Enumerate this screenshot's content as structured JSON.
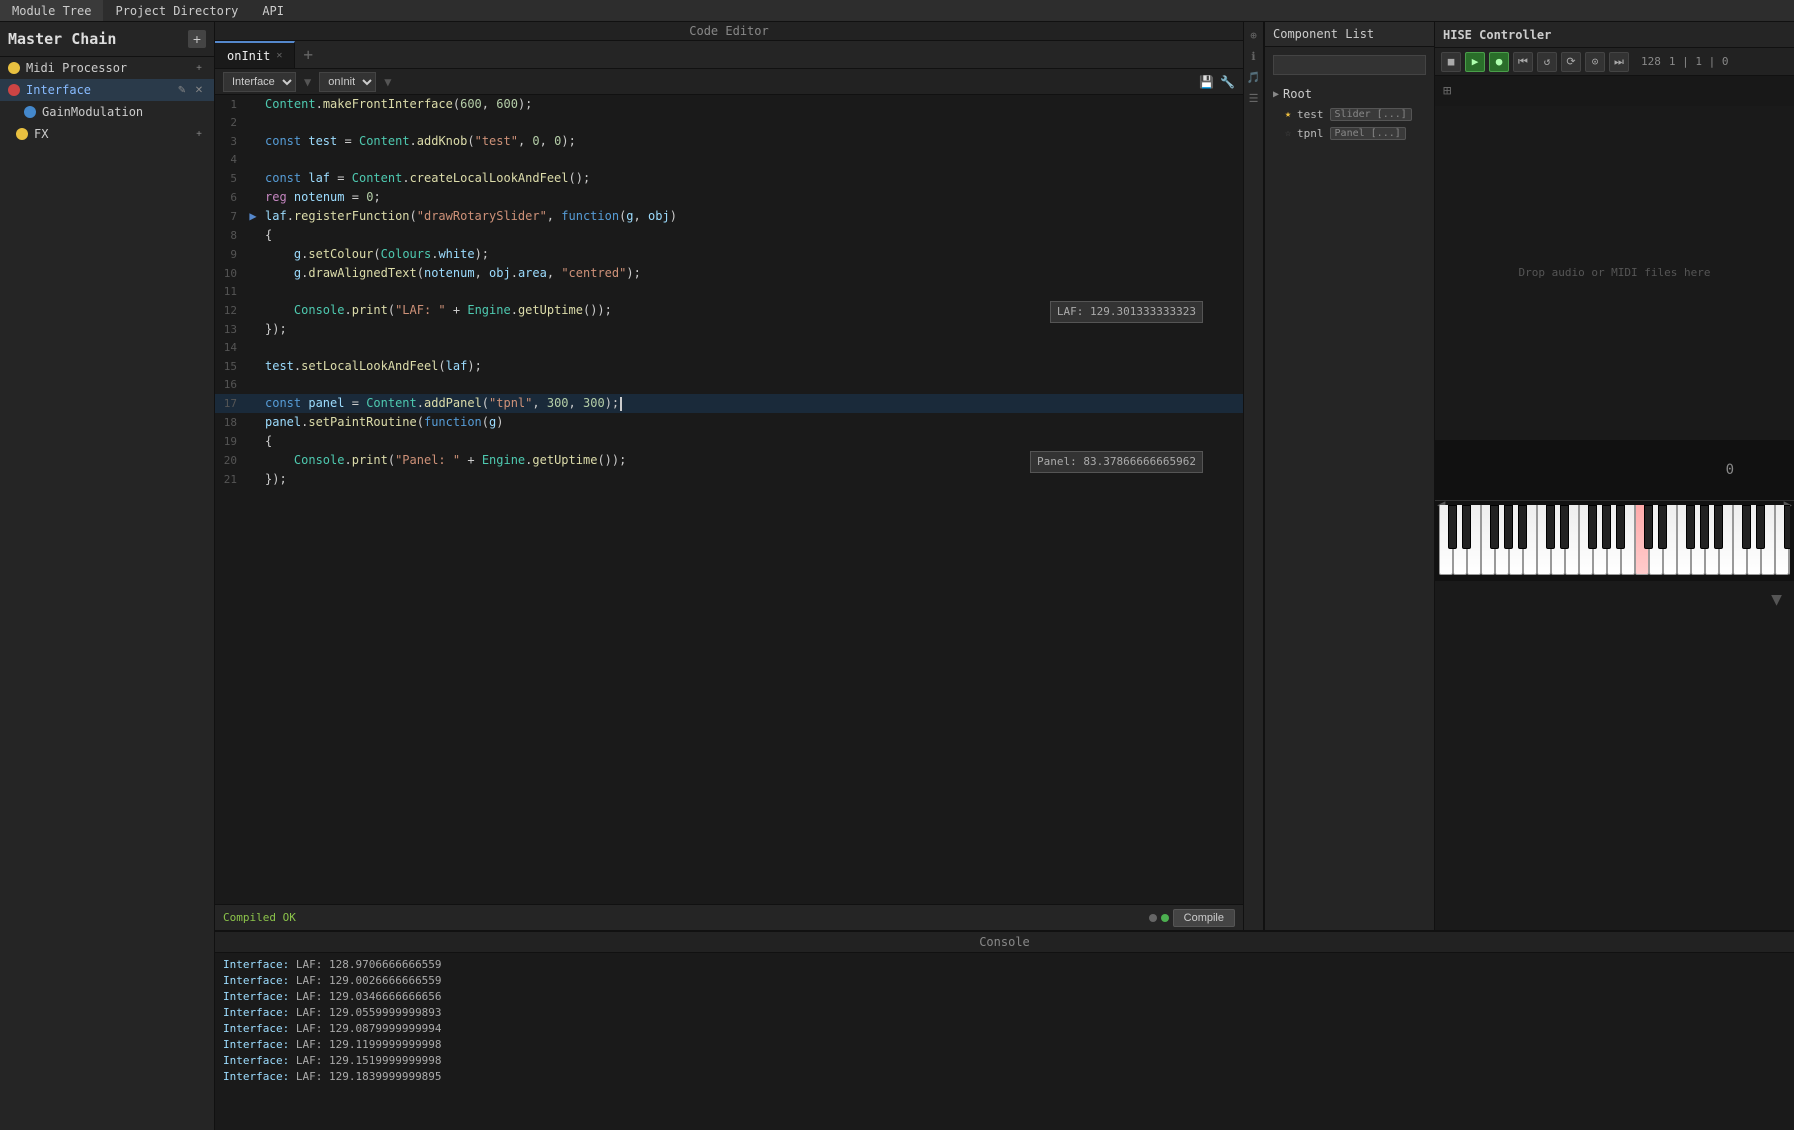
{
  "topMenu": {
    "items": [
      "Module Tree",
      "Project Directory",
      "API"
    ]
  },
  "leftPanel": {
    "masterChain": {
      "title": "Master Chain"
    },
    "modules": [
      {
        "id": "midi-processor",
        "name": "Midi Processor",
        "dotClass": "dot-yellow",
        "indent": 0
      },
      {
        "id": "interface",
        "name": "Interface",
        "dotClass": "dot-red",
        "indent": 0,
        "active": true
      },
      {
        "id": "gain-modulation",
        "name": "GainModulation",
        "dotClass": "dot-blue",
        "indent": 0
      },
      {
        "id": "fx",
        "name": "FX",
        "dotClass": "dot-yellow",
        "indent": 0
      }
    ]
  },
  "editorTabs": {
    "title": "Code Editor",
    "tabs": [
      {
        "label": "onInit",
        "active": true,
        "closeable": true
      }
    ],
    "addLabel": "+",
    "toolbar": {
      "fileSelect": "Interface",
      "callbackSelect": "onInit",
      "icons": [
        "💾",
        "🔧"
      ]
    }
  },
  "codeLines": [
    {
      "num": 1,
      "content": "Content.makeFrontInterface(600, 600);",
      "highlighted": false
    },
    {
      "num": 2,
      "content": "",
      "highlighted": false
    },
    {
      "num": 3,
      "content": "const test = Content.addKnob(\"test\", 0, 0);",
      "highlighted": false
    },
    {
      "num": 4,
      "content": "",
      "highlighted": false
    },
    {
      "num": 5,
      "content": "const laf = Content.createLocalLookAndFeel();",
      "highlighted": false
    },
    {
      "num": 6,
      "content": "reg notenum = 0;",
      "highlighted": false
    },
    {
      "num": 7,
      "content": "laf.registerFunction(\"drawRotarySlider\", function(g, obj)",
      "highlighted": false,
      "hasIndicator": true
    },
    {
      "num": 8,
      "content": "{",
      "highlighted": false
    },
    {
      "num": 9,
      "content": "    g.setColour(Colours.white);",
      "highlighted": false
    },
    {
      "num": 10,
      "content": "    g.drawAlignedText(notenum, obj.area, \"centred\");",
      "highlighted": false
    },
    {
      "num": 11,
      "content": "",
      "highlighted": false
    },
    {
      "num": 12,
      "content": "    Console.print(\"LAF: \" + Engine.getUptime());",
      "highlighted": false,
      "tooltip": "LAF: 129.301333333323"
    },
    {
      "num": 13,
      "content": "});",
      "highlighted": false
    },
    {
      "num": 14,
      "content": "",
      "highlighted": false
    },
    {
      "num": 15,
      "content": "test.setLocalLookAndFeel(laf);",
      "highlighted": false
    },
    {
      "num": 16,
      "content": "",
      "highlighted": false
    },
    {
      "num": 17,
      "content": "const panel = Content.addPanel(\"tpnl\", 300, 300);",
      "highlighted": true
    },
    {
      "num": 18,
      "content": "panel.setPaintRoutine(function(g)",
      "highlighted": false
    },
    {
      "num": 19,
      "content": "{",
      "highlighted": false
    },
    {
      "num": 20,
      "content": "    Console.print(\"Panel: \" + Engine.getUptime());",
      "highlighted": false,
      "tooltip": "Panel: 83.37866666665962"
    },
    {
      "num": 21,
      "content": "});",
      "highlighted": false
    }
  ],
  "statusBar": {
    "compiledText": "Compiled OK",
    "compileLabel": "Compile"
  },
  "console": {
    "title": "Console",
    "lines": [
      "Interface: LAF: 128.9706666666559",
      "Interface: LAF: 129.0026666666559",
      "Interface: LAF: 129.0346666666656",
      "Interface: LAF: 129.0559999999893",
      "Interface: LAF: 129.0879999999994",
      "Interface: LAF: 129.1199999999998",
      "Interface: LAF: 129.1519999999998",
      "Interface: LAF: 129.1839999999895"
    ]
  },
  "componentList": {
    "title": "Component List",
    "searchPlaceholder": "",
    "root": "Root",
    "items": [
      {
        "name": "test",
        "badge": "Slider [...]",
        "starred": true
      },
      {
        "name": "tpnl",
        "badge": "Panel [...]",
        "starred": false
      }
    ]
  },
  "hiseController": {
    "title": "HISE Controller",
    "toolbar": {
      "buttons": [
        {
          "label": "■",
          "class": ""
        },
        {
          "label": "▶",
          "class": "green"
        },
        {
          "label": "●",
          "class": "green"
        },
        {
          "label": "⏮",
          "class": ""
        },
        {
          "label": "↺",
          "class": ""
        },
        {
          "label": "⟳",
          "class": ""
        },
        {
          "label": "⊙",
          "class": ""
        },
        {
          "label": "⏭",
          "class": ""
        }
      ],
      "tempo": "128",
      "time": "1 | 1 | 0"
    },
    "dropZone": "Drop audio or MIDI files here",
    "oscilloscope": {
      "value": "0"
    }
  },
  "icons": {
    "search": "🔍",
    "settings": "⚙",
    "close": "✕",
    "add": "+",
    "star": "★",
    "triangle": "▶",
    "grid": "⊞"
  }
}
